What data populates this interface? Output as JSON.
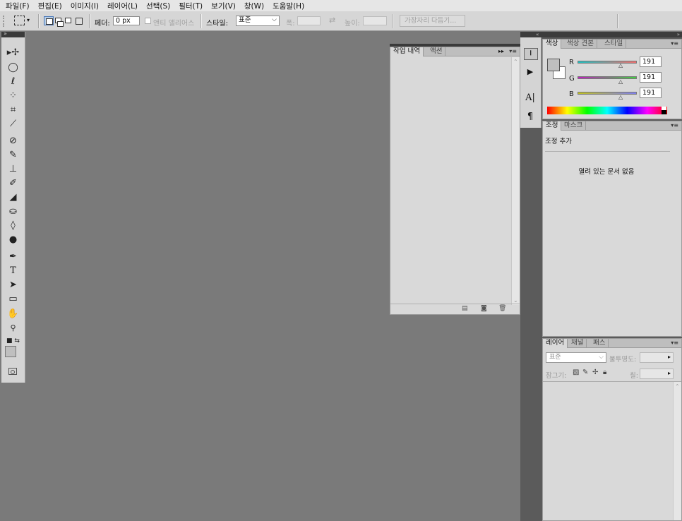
{
  "menu": [
    "파일(F)",
    "편집(E)",
    "이미지(I)",
    "레이어(L)",
    "선택(S)",
    "필터(T)",
    "보기(V)",
    "창(W)",
    "도움말(H)"
  ],
  "options": {
    "feather_label": "페더:",
    "feather_value": "0 px",
    "antialias_label": "앤티 앨리어스",
    "style_label": "스타일:",
    "style_value": "표준",
    "width_label": "폭:",
    "height_label": "높이:",
    "refine_edge": "가장자리 다듬기..."
  },
  "history_panel": {
    "tabs": [
      "작업 내역",
      "액션"
    ]
  },
  "color_panel": {
    "tabs": [
      "색상",
      "색상 견본",
      "스타일"
    ],
    "channels": [
      {
        "label": "R",
        "value": "191",
        "gradient": [
          "#20c0c0",
          "#f07070"
        ]
      },
      {
        "label": "G",
        "value": "191",
        "gradient": [
          "#c020c0",
          "#40d040"
        ]
      },
      {
        "label": "B",
        "value": "191",
        "gradient": [
          "#c0c020",
          "#8080f0"
        ]
      }
    ],
    "fg_color": "#bfbfbf"
  },
  "adjust_panel": {
    "tabs": [
      "조정",
      "마스크"
    ],
    "title": "조정 추가",
    "empty_message": "열려 있는 문서 없음"
  },
  "layers_panel": {
    "tabs": [
      "레이어",
      "채널",
      "패스"
    ],
    "blend_mode": "표준",
    "opacity_label": "불투명도:",
    "lock_label": "잠그기:",
    "fill_label": "칠:"
  }
}
